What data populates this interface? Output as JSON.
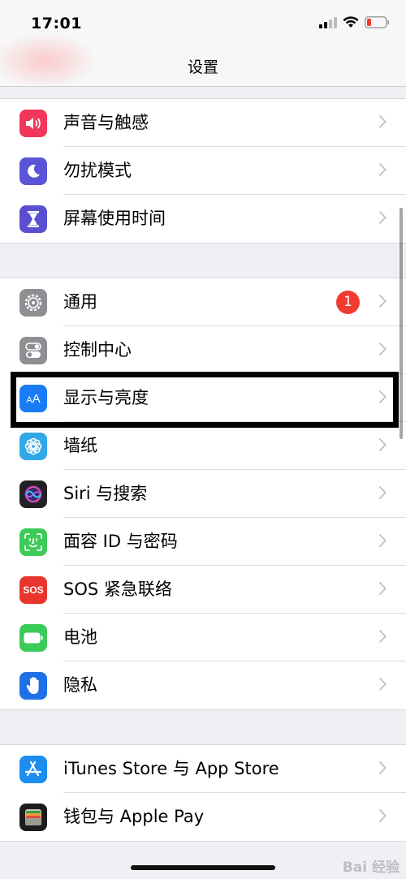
{
  "status_bar": {
    "time": "17:01"
  },
  "nav": {
    "title": "设置"
  },
  "groups": [
    {
      "items": [
        {
          "label": "声音与触感",
          "icon": "speaker-icon",
          "color": "#f2365a"
        },
        {
          "label": "勿扰模式",
          "icon": "moon-icon",
          "color": "#5a55d6"
        },
        {
          "label": "屏幕使用时间",
          "icon": "hourglass-icon",
          "color": "#5a4fd0"
        }
      ]
    },
    {
      "items": [
        {
          "label": "通用",
          "icon": "gear-icon",
          "color": "#8e8e93",
          "badge": "1"
        },
        {
          "label": "控制中心",
          "icon": "toggles-icon",
          "color": "#8e8e93"
        },
        {
          "label": "显示与亮度",
          "icon": "text-size-icon",
          "color": "#1a7cf5",
          "icon_text": "AA"
        },
        {
          "label": "墙纸",
          "icon": "flower-icon",
          "color": "#31a8e6"
        },
        {
          "label": "Siri 与搜索",
          "icon": "siri-icon",
          "color": "#222222"
        },
        {
          "label": "面容 ID 与密码",
          "icon": "face-id-icon",
          "color": "#3ccb58"
        },
        {
          "label": "SOS 紧急联络",
          "icon": "sos-icon",
          "color": "#e9352d",
          "icon_text": "SOS"
        },
        {
          "label": "电池",
          "icon": "battery-icon",
          "color": "#3ccb58"
        },
        {
          "label": "隐私",
          "icon": "hand-icon",
          "color": "#1f6fe6"
        }
      ]
    },
    {
      "items": [
        {
          "label": "iTunes Store 与 App Store",
          "icon": "app-store-icon",
          "color": "#1d8ef0"
        },
        {
          "label": "钱包与 Apple Pay",
          "icon": "wallet-icon",
          "color": "#1c1c1e"
        }
      ]
    }
  ],
  "watermark": "Bai 经验",
  "colors": {
    "badge": "#f03b30",
    "background": "#efeff4"
  }
}
